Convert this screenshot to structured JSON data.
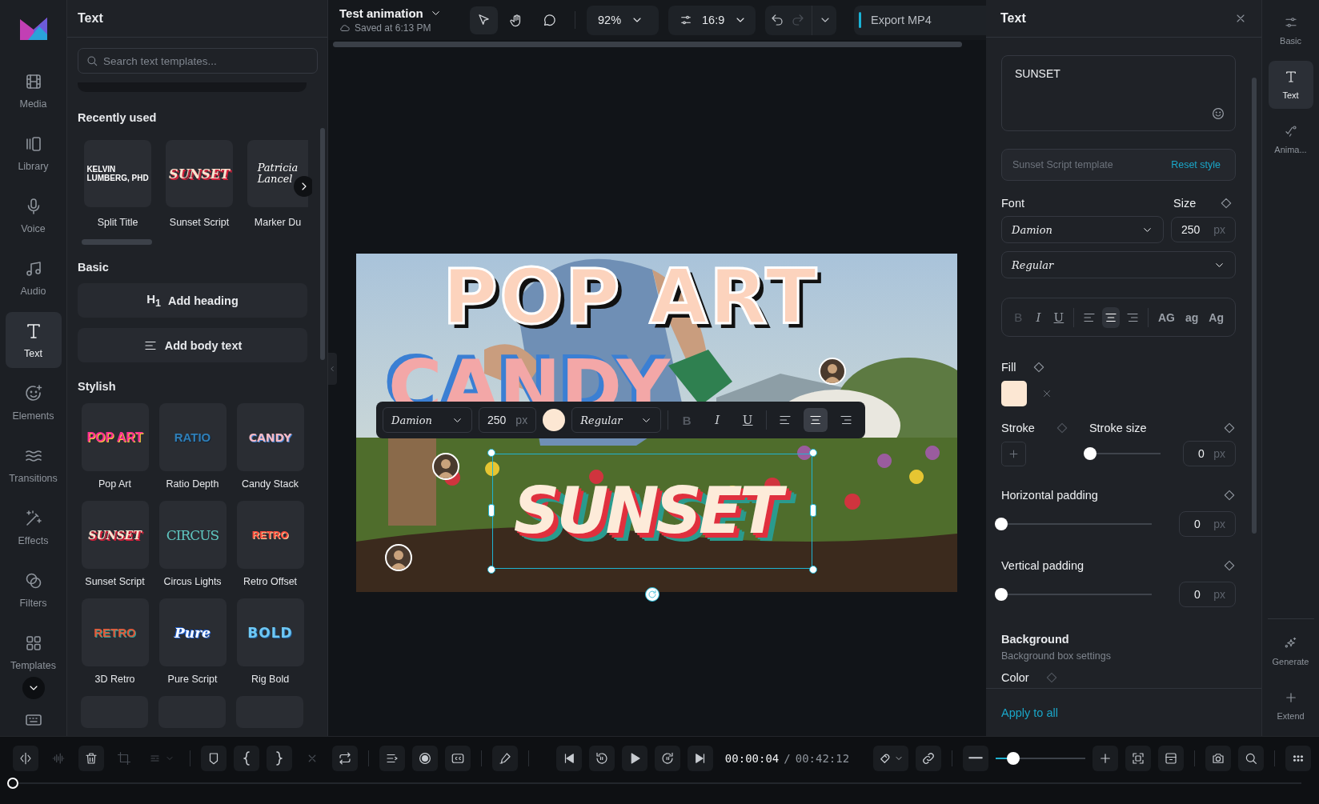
{
  "rail": {
    "items": [
      {
        "label": "Media",
        "selected": false
      },
      {
        "label": "Library",
        "selected": false
      },
      {
        "label": "Voice",
        "selected": false
      },
      {
        "label": "Audio",
        "selected": false
      },
      {
        "label": "Text",
        "selected": true
      },
      {
        "label": "Elements",
        "selected": false
      },
      {
        "label": "Transitions",
        "selected": false
      },
      {
        "label": "Effects",
        "selected": false
      },
      {
        "label": "Filters",
        "selected": false
      },
      {
        "label": "Templates",
        "selected": false
      }
    ]
  },
  "templates_panel": {
    "title": "Text",
    "search": {
      "placeholder": "Search text templates..."
    },
    "recent": {
      "title": "Recently used",
      "items": [
        {
          "name": "Split Title",
          "preview": [
            "KELVIN",
            "LUMBERG, PHD"
          ]
        },
        {
          "name": "Sunset Script",
          "preview": [
            "SUNSET"
          ]
        },
        {
          "name": "Marker Du",
          "preview": [
            "Patricia",
            "Lancel"
          ]
        }
      ]
    },
    "basic": {
      "title": "Basic",
      "buttons": [
        {
          "kind": "heading",
          "glyph": "H$_{1}$",
          "label": "Add heading"
        },
        {
          "kind": "body",
          "label": "Add body text"
        }
      ]
    },
    "stylish": {
      "title": "Stylish",
      "items": [
        {
          "name": "Pop Art",
          "preview": "POP ART"
        },
        {
          "name": "Ratio Depth",
          "preview": "RATIO"
        },
        {
          "name": "Candy Stack",
          "preview": "CANDY"
        },
        {
          "name": "Sunset Script",
          "preview": "SUNSET"
        },
        {
          "name": "Circus Lights",
          "preview": "CIRCUS"
        },
        {
          "name": "Retro Offset",
          "preview": "RETRO"
        },
        {
          "name": "3D Retro",
          "preview": "RETRO"
        },
        {
          "name": "Pure Script",
          "preview": "Pure"
        },
        {
          "name": "Rig Bold",
          "preview": "BOLD"
        }
      ]
    }
  },
  "topbar": {
    "project": "Test animation",
    "saved": "Saved at 6:13 PM",
    "tools": [
      {
        "kind": "select",
        "selected": true
      },
      {
        "kind": "hand",
        "selected": false
      },
      {
        "kind": "comment",
        "selected": false
      }
    ],
    "zoom": "92%",
    "ratio": "16:9",
    "history": [
      {
        "kind": "undo",
        "disabled": false
      },
      {
        "kind": "redo",
        "disabled": true
      }
    ],
    "export": "Export MP4"
  },
  "canvas": {
    "layers": [
      {
        "kind": "pop",
        "text": "POP ART"
      },
      {
        "kind": "candy",
        "text": "CANDY"
      },
      {
        "kind": "sunset",
        "text": "SUNSET",
        "selected": true
      }
    ],
    "toolbar": {
      "font": "Damion",
      "size": "250",
      "unit": "px",
      "color": "#fce7d3",
      "weight": "Regular",
      "format": [
        {
          "glyph": "B",
          "disabled": true
        },
        {
          "glyph": "I",
          "disabled": false
        },
        {
          "glyph": "U",
          "disabled": false
        }
      ],
      "align": [
        {
          "kind": "left",
          "selected": false
        },
        {
          "kind": "center",
          "selected": true
        },
        {
          "kind": "right",
          "selected": false
        }
      ]
    }
  },
  "properties": {
    "title": "Text",
    "content": "SUNSET",
    "template": "Sunset Script template",
    "reset": "Reset style",
    "font_label": "Font",
    "size_label": "Size",
    "font": "Damion",
    "size": "250",
    "unit": "px",
    "weight": "Regular",
    "format": [
      {
        "glyph": "B",
        "disabled": true
      },
      {
        "glyph": "I",
        "disabled": false
      },
      {
        "glyph": "U",
        "disabled": false
      }
    ],
    "align": [
      {
        "kind": "left",
        "selected": false
      },
      {
        "kind": "center",
        "selected": true
      },
      {
        "kind": "right",
        "selected": false
      }
    ],
    "case": [
      "AG",
      "ag",
      "Ag"
    ],
    "fill": {
      "label": "Fill",
      "color": "#fce7d3"
    },
    "stroke": {
      "label": "Stroke",
      "size_label": "Stroke size",
      "level": 0,
      "value": "0",
      "unit": "px"
    },
    "hpad": {
      "label": "Horizontal padding",
      "level": 0,
      "value": "0",
      "unit": "px"
    },
    "vpad": {
      "label": "Vertical padding",
      "level": 0,
      "value": "0",
      "unit": "px"
    },
    "background": {
      "title": "Background",
      "subtitle": "Background box settings",
      "color_label": "Color"
    },
    "apply": "Apply to all"
  },
  "right_rail": {
    "items": [
      {
        "label": "Basic",
        "selected": false
      },
      {
        "label": "Text",
        "selected": true
      },
      {
        "label": "Anima...",
        "selected": false
      }
    ],
    "actions": [
      "Generate",
      "Extend"
    ]
  },
  "timeline": {
    "tools": [
      {
        "kind": "split",
        "disabled": false
      },
      {
        "kind": "waveform",
        "disabled": true
      },
      {
        "kind": "delete",
        "disabled": false
      },
      {
        "kind": "crop",
        "disabled": true
      },
      {
        "kind": "detach",
        "disabled": true
      },
      {
        "kind": "marker",
        "disabled": false
      },
      {
        "kind": "mark_in",
        "disabled": false
      },
      {
        "kind": "mark_out",
        "disabled": false
      },
      {
        "kind": "clear",
        "disabled": true
      },
      {
        "kind": "loop",
        "disabled": false
      },
      {
        "kind": "list",
        "disabled": false
      },
      {
        "kind": "record",
        "disabled": false
      },
      {
        "kind": "captions",
        "disabled": false
      },
      {
        "kind": "pen",
        "disabled": false
      }
    ],
    "current": "00:00:04",
    "separator": "/",
    "total": "00:42:12",
    "zoom": {
      "level": 0.2
    },
    "playhead": {
      "level": 0
    }
  }
}
